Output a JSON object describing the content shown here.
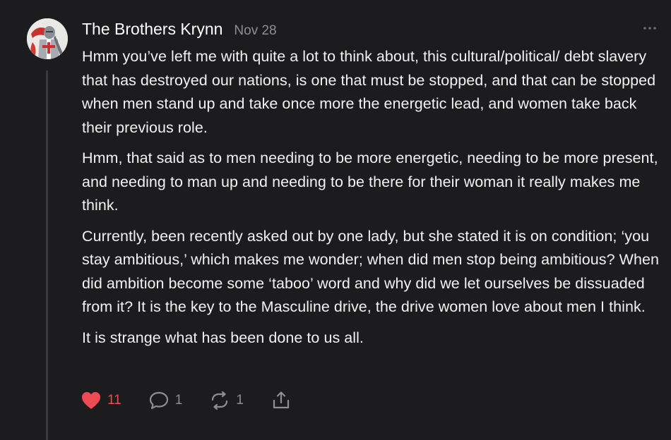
{
  "comment": {
    "author": "The Brothers Krynn",
    "date": "Nov 28",
    "avatar_icon": "knight-avatar",
    "paragraphs": [
      "Hmm you’ve left me with quite a lot to think about, this cultural/political/ debt slavery that has destroyed our nations, is one that must be stopped, and that can be stopped when men stand up and take once more the energetic lead, and women take back their previous role.",
      "Hmm, that said as to men needing to be more energetic, needing to be more present, and needing to man up and needing to be there for their woman it really makes me think.",
      "Currently, been recently asked out by one lady, but she stated it is on condition; ‘you stay ambitious,’ which makes me wonder; when did men stop being ambitious? When did ambition become some ‘taboo’ word and why did we let ourselves be dissuaded from it? It is the key to the Masculine drive, the drive women love about men I think.",
      "It is strange what has been done to us all."
    ],
    "actions": {
      "likes": "11",
      "replies": "1",
      "restacks": "1",
      "like_icon": "heart-icon",
      "reply_icon": "speech-bubble-icon",
      "restack_icon": "restack-icon",
      "share_icon": "share-icon"
    },
    "colors": {
      "background": "#1c1c1e",
      "liked": "#ee4b55",
      "muted": "#8e8e93"
    }
  }
}
